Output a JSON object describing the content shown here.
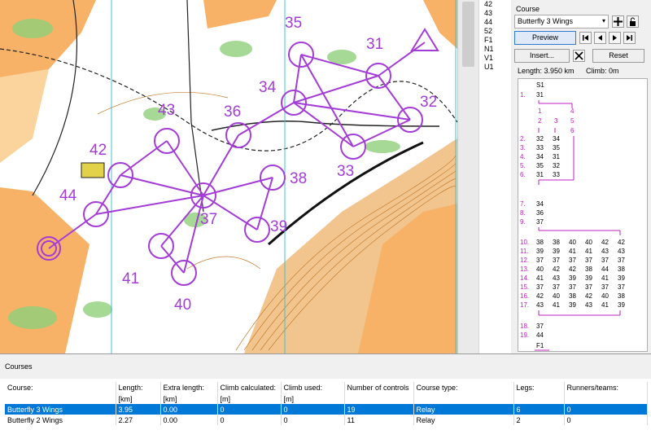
{
  "map": {
    "controls": [
      {
        "code": "31"
      },
      {
        "code": "32"
      },
      {
        "code": "33"
      },
      {
        "code": "34"
      },
      {
        "code": "35"
      },
      {
        "code": "36"
      },
      {
        "code": "37"
      },
      {
        "code": "38"
      },
      {
        "code": "39"
      },
      {
        "code": "40"
      },
      {
        "code": "41"
      },
      {
        "code": "42"
      },
      {
        "code": "43"
      },
      {
        "code": "44"
      }
    ]
  },
  "control_codes": [
    "42",
    "43",
    "44",
    "52",
    "F1",
    "N1",
    "V1",
    "U1"
  ],
  "course_panel": {
    "title": "Course",
    "selected_course": "Butterfly 3 Wings",
    "preview_label": "Preview",
    "insert_label": "Insert...",
    "reset_label": "Reset",
    "length_text": "Length: 3.950 km",
    "climb_text": "Climb: 0m",
    "legs": {
      "start": "S1",
      "finish": "F1",
      "rows": [
        {
          "n": "1.",
          "a": "31"
        },
        {
          "n": "2.",
          "a": "32",
          "b": "34"
        },
        {
          "n": "3.",
          "a": "33",
          "b": "35"
        },
        {
          "n": "4.",
          "a": "34",
          "b": "31"
        },
        {
          "n": "5.",
          "a": "35",
          "b": "32"
        },
        {
          "n": "6.",
          "a": "31",
          "b": "33"
        },
        {
          "n": "7.",
          "a": "34"
        },
        {
          "n": "8.",
          "a": "36"
        },
        {
          "n": "9.",
          "a": "37"
        },
        {
          "n": "10.",
          "cols": [
            "38",
            "38",
            "40",
            "40",
            "42",
            "42"
          ]
        },
        {
          "n": "11.",
          "cols": [
            "39",
            "39",
            "41",
            "41",
            "43",
            "43"
          ]
        },
        {
          "n": "12.",
          "cols": [
            "37",
            "37",
            "37",
            "37",
            "37",
            "37"
          ]
        },
        {
          "n": "13.",
          "cols": [
            "40",
            "42",
            "42",
            "38",
            "44",
            "38"
          ]
        },
        {
          "n": "14.",
          "cols": [
            "41",
            "43",
            "39",
            "39",
            "41",
            "39"
          ]
        },
        {
          "n": "15.",
          "cols": [
            "37",
            "37",
            "37",
            "37",
            "37",
            "37"
          ]
        },
        {
          "n": "16.",
          "cols": [
            "42",
            "40",
            "38",
            "42",
            "40",
            "38"
          ]
        },
        {
          "n": "17.",
          "cols": [
            "43",
            "41",
            "39",
            "43",
            "41",
            "39"
          ]
        },
        {
          "n": "18.",
          "a": "37"
        },
        {
          "n": "19.",
          "a": "44"
        }
      ],
      "branch_labels": [
        "1",
        "2",
        "3",
        "4",
        "5",
        "6"
      ]
    }
  },
  "courses_table": {
    "title": "Courses",
    "headers": [
      "Course:",
      "Length:",
      "Extra length:",
      "Climb calculated:",
      "Climb used:",
      "Number of controls",
      "Course type:",
      "Legs:",
      "Runners/teams:"
    ],
    "units": [
      "",
      "[km]",
      "[km]",
      "[m]",
      "[m]",
      "",
      "",
      "",
      ""
    ],
    "rows": [
      [
        "Butterfly 3 Wings",
        "3.95",
        "0.00",
        "0",
        "0",
        "19",
        "Relay",
        "6",
        "0"
      ],
      [
        "Butterfly 2 Wings",
        "2.27",
        "0.00",
        "0",
        "0",
        "11",
        "Relay",
        "2",
        "0"
      ]
    ]
  },
  "colors": {
    "course_purple": "#a43cd8",
    "accent": "#0078d7",
    "leg_magenta": "#c020c0"
  }
}
